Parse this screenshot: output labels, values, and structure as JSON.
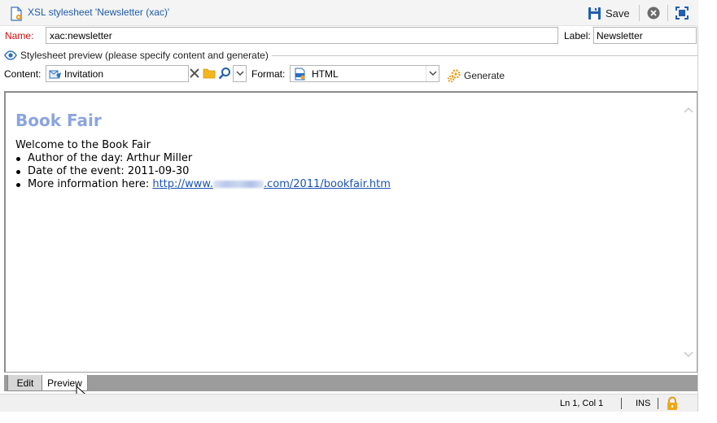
{
  "window": {
    "title": "XSL stylesheet 'Newsletter (xac)'",
    "save_label": "Save"
  },
  "form": {
    "name_label": "Name:",
    "name_value": "xac:newsletter",
    "label_label": "Label:",
    "label_value": "Newsletter"
  },
  "preview_section": {
    "heading": "Stylesheet preview (please specify content and generate)",
    "content_label": "Content:",
    "content_value": "Invitation",
    "format_label": "Format:",
    "format_value": "HTML",
    "generate_label": "Generate"
  },
  "document": {
    "heading": "Book Fair",
    "intro": "Welcome to the Book Fair",
    "items": [
      "Author of the day: Arthur Miller",
      "Date of the event: 2011-09-30"
    ],
    "more_info_prefix": "More information here: ",
    "link_start": "http://www.",
    "link_end": ".com/2011/bookfair.htm"
  },
  "tabs": {
    "edit": "Edit",
    "preview": "Preview",
    "active": "Preview"
  },
  "status": {
    "position": "Ln 1, Col 1",
    "mode": "INS"
  },
  "colors": {
    "title_text": "#1e5aa8",
    "name_label": "#d01010",
    "doc_heading": "#8aa5e0",
    "link": "#1b53b5",
    "tab_bar": "#9c9c9c"
  },
  "icons": [
    "stylesheet-icon",
    "save-icon",
    "close-circle-icon",
    "maximize-icon",
    "eye-icon",
    "delivery-icon",
    "clear-icon",
    "folder-icon",
    "search-icon",
    "dropdown-arrow-icon",
    "html-format-icon",
    "gears-icon",
    "scroll-up-icon",
    "scroll-down-icon",
    "mouse-cursor",
    "lock-icon"
  ]
}
